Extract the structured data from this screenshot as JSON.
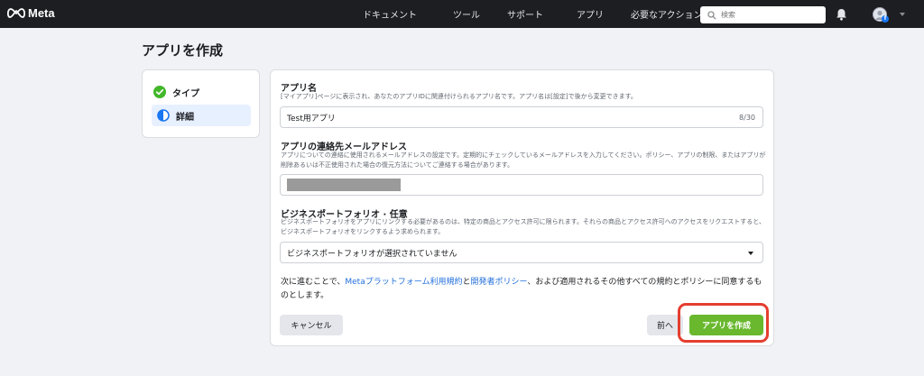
{
  "topbar": {
    "logo_text": "Meta",
    "nav": [
      "ドキュメント",
      "ツール",
      "サポート",
      "アプリ",
      "必要なアクション"
    ],
    "search_placeholder": "検索",
    "avatar_badge": "f"
  },
  "page_title": "アプリを作成",
  "steps": [
    {
      "label": "タイプ",
      "state": "done"
    },
    {
      "label": "詳細",
      "state": "current"
    }
  ],
  "form": {
    "app_name": {
      "title": "アプリ名",
      "description": "[マイアプリ]ページに表示され、あなたのアプリIDに関連付けられるアプリ名です。アプリ名は[設定]で後から変更できます。",
      "value": "Test用アプリ",
      "counter": "8/30"
    },
    "email": {
      "title": "アプリの連絡先メールアドレス",
      "description": "アプリについての連絡に使用されるメールアドレスの設定です。定期的にチェックしているメールアドレスを入力してください。ポリシー、アプリの制限、またはアプリが削除あるいは不正使用された場合の復元方法についてご連絡する場合があります。"
    },
    "portfolio": {
      "title": "ビジネスポートフォリオ · 任意",
      "description": "ビジネスポートフォリオをアプリにリンクする必要があるのは、特定の商品とアクセス許可に限られます。それらの商品とアクセス許可へのアクセスをリクエストすると、ビジネスポートフォリオをリンクするよう求められます。",
      "selected": "ビジネスポートフォリオが選択されていません"
    },
    "terms": {
      "prefix": "次に進むことで、",
      "link1": "Metaプラットフォーム利用規約",
      "middle": "と",
      "link2": "開発者ポリシー",
      "suffix": "、および適用されるその他すべての規約とポリシーに同意するものとします。"
    },
    "buttons": {
      "cancel": "キャンセル",
      "prev": "前へ",
      "create": "アプリを作成"
    }
  },
  "colors": {
    "topbar": "#1c1e21",
    "accent_link": "#216fdb",
    "create_button": "#69b82e",
    "highlight_border": "#e53e2f",
    "step_done": "#42b72a",
    "step_current": "#1877f2"
  }
}
